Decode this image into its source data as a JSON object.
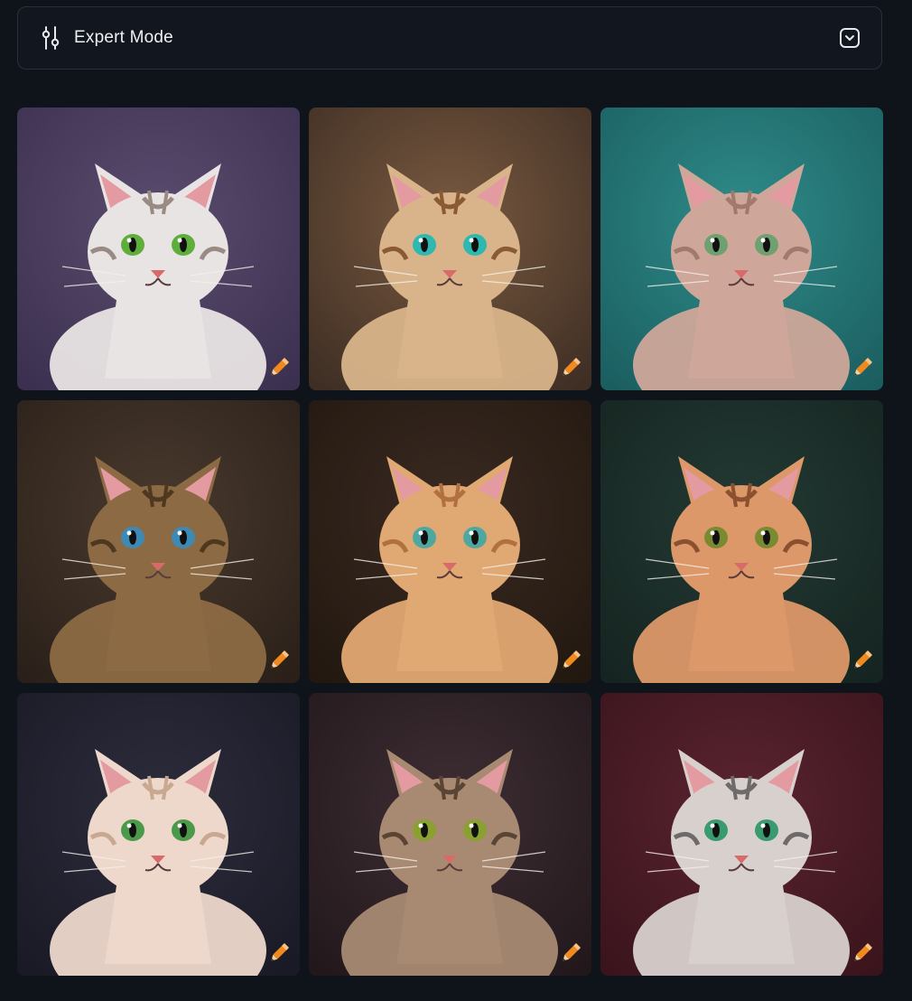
{
  "expert_mode": {
    "label": "Expert Mode",
    "icon": "sliders-icon",
    "toggle_icon": "chevron-down-icon"
  },
  "gallery": {
    "tiles": [
      {
        "subject": "cat",
        "bg": "#5a4c6e",
        "bg2": "#3c3050",
        "fur": "#e9e4e4",
        "stripe": "#9a8a84",
        "eyes": "#5fae3c",
        "edit_icon": "pencil-icon"
      },
      {
        "subject": "cat",
        "bg": "#7a5a40",
        "bg2": "#3e2e24",
        "fur": "#d9b48a",
        "stripe": "#8a5a32",
        "eyes": "#2fb8b0",
        "edit_icon": "pencil-icon"
      },
      {
        "subject": "cat",
        "bg": "#2f8c8a",
        "bg2": "#1b5e60",
        "fur": "#cfa79a",
        "stripe": "#a07a6c",
        "eyes": "#6fa070",
        "edit_icon": "pencil-icon"
      },
      {
        "subject": "cat",
        "bg": "#4a3a2e",
        "bg2": "#2a2019",
        "fur": "#8c6a44",
        "stripe": "#4e3820",
        "eyes": "#3f8ab4",
        "edit_icon": "pencil-icon"
      },
      {
        "subject": "cat",
        "bg": "#3a2a22",
        "bg2": "#22180f",
        "fur": "#e0a872",
        "stripe": "#b07040",
        "eyes": "#4fa8a0",
        "edit_icon": "pencil-icon"
      },
      {
        "subject": "cat",
        "bg": "#243a34",
        "bg2": "#152420",
        "fur": "#dc9868",
        "stripe": "#8a5030",
        "eyes": "#7a8a30",
        "edit_icon": "pencil-icon"
      },
      {
        "subject": "cat",
        "bg": "#2c2c3c",
        "bg2": "#1a1a26",
        "fur": "#eed8cc",
        "stripe": "#c8a890",
        "eyes": "#4a9a4a",
        "edit_icon": "pencil-icon"
      },
      {
        "subject": "cat",
        "bg": "#3e2e34",
        "bg2": "#22181c",
        "fur": "#a88a72",
        "stripe": "#5a4434",
        "eyes": "#8aa030",
        "edit_icon": "pencil-icon"
      },
      {
        "subject": "cat",
        "bg": "#5a2430",
        "bg2": "#3a141c",
        "fur": "#d8d0cc",
        "stripe": "#6e6a6a",
        "eyes": "#3a9a70",
        "edit_icon": "pencil-icon"
      }
    ]
  },
  "colors": {
    "page_bg": "#0f131a",
    "panel_border": "#2a303b",
    "pencil": "#f08a1e"
  }
}
